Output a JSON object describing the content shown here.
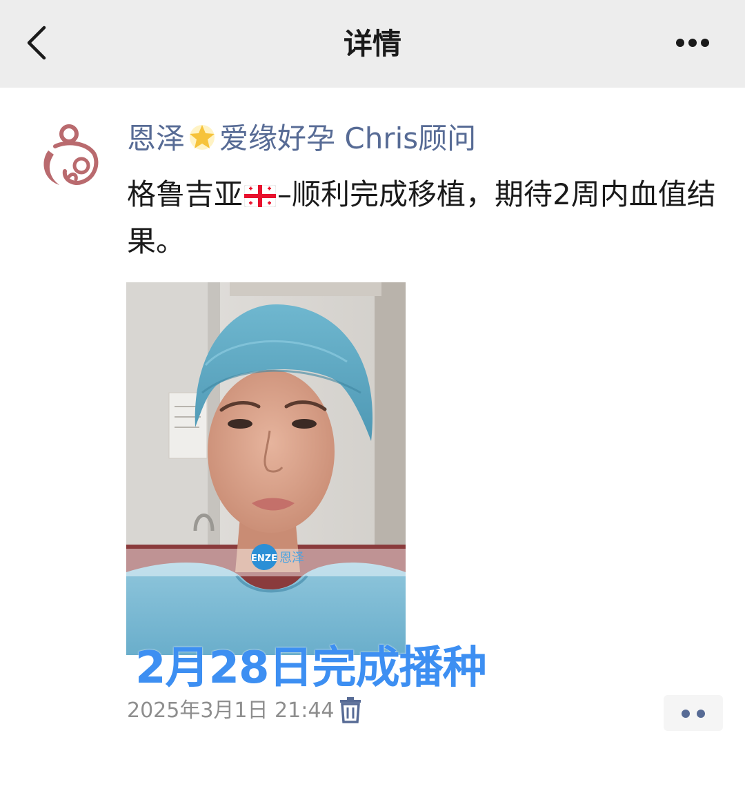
{
  "navbar": {
    "title": "详情",
    "back_icon": "chevron-left-icon",
    "more_icon": "more-horizontal-icon"
  },
  "post": {
    "author_part1": "恩泽",
    "author_emoji": "glowing-star-icon",
    "author_part2": "爱缘好孕 Chris顾问",
    "text_part1": "格鲁吉亚",
    "flag_emoji": "georgia-flag-icon",
    "text_part2": "–顺利完成移植，期待2周内血值结果。",
    "image_caption": "2月28日完成播种",
    "image_watermark_logo": "ENZE",
    "image_watermark_text": "恩泽",
    "timestamp": "2025年3月1日 21:44",
    "delete_icon": "trash-icon",
    "action_icon": "more-dots-icon"
  },
  "colors": {
    "navbar_bg": "#ededed",
    "author_name": "#576b95",
    "caption": "#3d8ff2",
    "timestamp": "#8e8e8e",
    "avatar_brand": "#b96a6e"
  }
}
